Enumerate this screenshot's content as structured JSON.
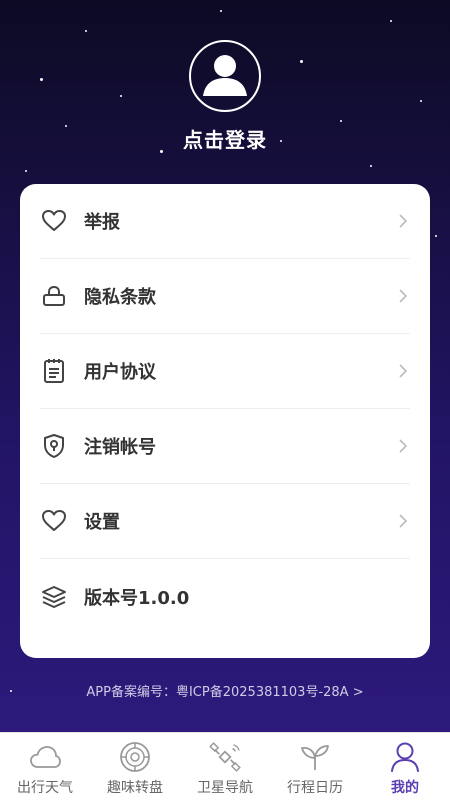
{
  "header": {
    "login_text": "点击登录"
  },
  "menu": [
    {
      "label": "举报",
      "icon": "heart-icon",
      "chevron": true
    },
    {
      "label": "隐私条款",
      "icon": "lock-icon",
      "chevron": true
    },
    {
      "label": "用户协议",
      "icon": "clipboard-icon",
      "chevron": true
    },
    {
      "label": "注销帐号",
      "icon": "shield-icon",
      "chevron": true
    },
    {
      "label": "设置",
      "icon": "heart-icon",
      "chevron": true
    },
    {
      "label": "版本号1.0.0",
      "icon": "layers-icon",
      "chevron": false
    }
  ],
  "footer": {
    "icp": "APP备案编号：粤ICP备2025381103号-28A >"
  },
  "tabs": [
    {
      "label": "出行天气",
      "icon": "cloud-icon",
      "active": false
    },
    {
      "label": "趣味转盘",
      "icon": "spinner-icon",
      "active": false
    },
    {
      "label": "卫星导航",
      "icon": "satellite-icon",
      "active": false
    },
    {
      "label": "行程日历",
      "icon": "sprout-icon",
      "active": false
    },
    {
      "label": "我的",
      "icon": "user-icon",
      "active": true
    }
  ],
  "colors": {
    "accent": "#5a3fb0",
    "bg_top": "#0c0a24",
    "bg_bottom": "#2d1a7c"
  }
}
